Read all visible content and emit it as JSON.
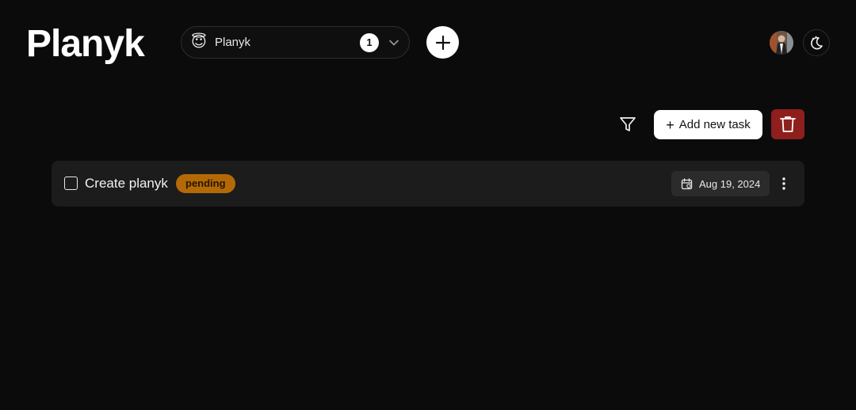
{
  "header": {
    "brand": "Planyk",
    "project_selector": {
      "emoji": "😇",
      "name": "Planyk",
      "count": "1"
    }
  },
  "toolbar": {
    "add_task_label": "Add new task",
    "add_task_icon": "+"
  },
  "tasks": [
    {
      "title": "Create planyk",
      "status": "pending",
      "due_date": "Aug 19, 2024",
      "checked": false
    }
  ],
  "colors": {
    "background": "#0b0b0b",
    "row_bg": "#1c1c1c",
    "pending_badge": "#b36a06",
    "delete_button": "#8e1f1d"
  },
  "icons": {
    "filter": "filter-icon",
    "delete": "trash-icon",
    "theme": "moon-icon",
    "calendar": "calendar-icon",
    "more": "more-vertical-icon"
  }
}
